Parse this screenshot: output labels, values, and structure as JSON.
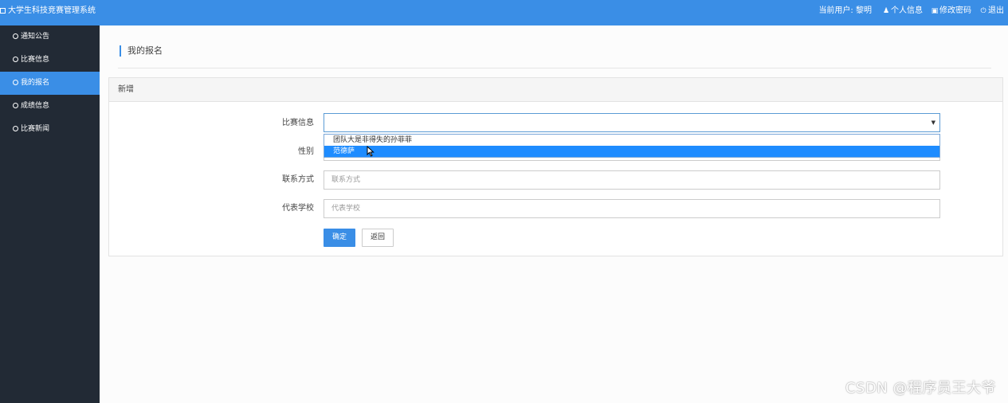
{
  "app": {
    "title": "大学生科技竞赛管理系统"
  },
  "topnav": {
    "current_user": "当前用户: 黎明",
    "profile": "个人信息",
    "change_password": "修改密码",
    "logout": "退出"
  },
  "sidebar": {
    "items": [
      {
        "label": "通知公告",
        "active": false
      },
      {
        "label": "比赛信息",
        "active": false
      },
      {
        "label": "我的报名",
        "active": true
      },
      {
        "label": "成绩信息",
        "active": false
      },
      {
        "label": "比赛新闻",
        "active": false
      }
    ]
  },
  "page": {
    "title": "我的报名",
    "panel_title": "新增"
  },
  "form": {
    "competition_label": "比赛信息",
    "competition_value": "",
    "competition_options": [
      "团队大是非得失的孙菲菲",
      "范德萨"
    ],
    "highlighted_option": "范德萨",
    "gender_label": "性别",
    "contact_label": "联系方式",
    "contact_placeholder": "联系方式",
    "school_label": "代表学校",
    "school_placeholder": "代表学校",
    "confirm_button": "确定",
    "back_button": "返回"
  },
  "watermark": "CSDN @程序员王大爷",
  "colors": {
    "accent": "#3a8ee6",
    "sidebar_bg": "#222a35",
    "highlight": "#1e8cff"
  },
  "icons": {
    "brand": "monitor-icon",
    "profile": "user-icon",
    "change_password": "lock-icon",
    "logout": "power-icon",
    "sidebar": "circle-icon",
    "select": "caret-down-icon"
  }
}
